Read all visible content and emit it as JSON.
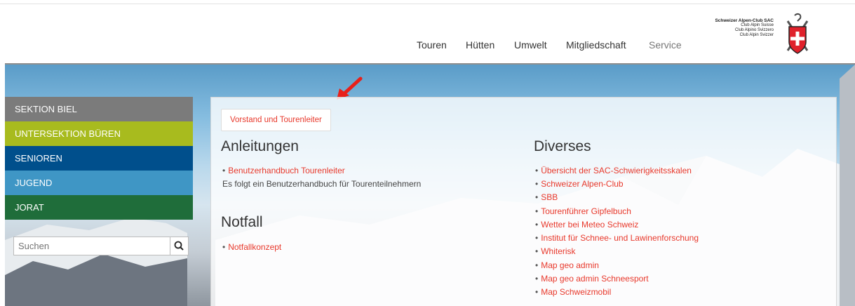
{
  "nav": {
    "items": [
      "Touren",
      "Hütten",
      "Umwelt",
      "Mitgliedschaft",
      "Service"
    ]
  },
  "logo": {
    "lines": [
      "Schweizer Alpen-Club SAC",
      "Club Alpin Suisse",
      "Club Alpino Svizzero",
      "Club Alpin Svizzer"
    ]
  },
  "sidebar": {
    "items": [
      {
        "label": "SEKTION BIEL",
        "color": "#7b7b7b"
      },
      {
        "label": "UNTERSEKTION BÜREN",
        "color": "#a8bb1e"
      },
      {
        "label": "SENIOREN",
        "color": "#004f8c"
      },
      {
        "label": "JUGEND",
        "color": "#3f96c5"
      },
      {
        "label": "JORAT",
        "color": "#1f6d3a"
      }
    ],
    "search_placeholder": "Suchen"
  },
  "panel": {
    "tab_label": "Vorstand und Tourenleiter",
    "left": {
      "section1": {
        "title": "Anleitungen",
        "link": "Benutzerhandbuch Tourenleiter",
        "note": "Es folgt ein Benutzerhandbuch für Tourenteilnehmern"
      },
      "section2": {
        "title": "Notfall",
        "link": "Notfallkonzept"
      }
    },
    "right": {
      "title": "Diverses",
      "links": [
        "Übersicht der SAC-Schwierigkeitsskalen",
        "Schweizer Alpen-Club",
        "SBB",
        "Tourenführer Gipfelbuch",
        "Wetter bei Meteo Schweiz",
        "Institut für Schnee- und Lawinenforschung",
        "Whiterisk",
        "Map geo admin",
        "Map geo admin Schneesport",
        "Map Schweizmobil"
      ]
    }
  },
  "colors": {
    "link": "#e8392c",
    "annotation_arrow": "#e8201a"
  }
}
